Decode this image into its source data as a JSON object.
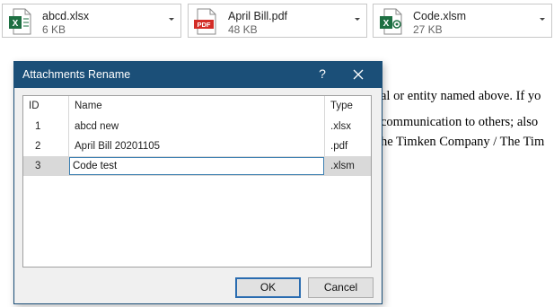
{
  "attachments": [
    {
      "name": "abcd.xlsx",
      "size": "6 KB",
      "icon": "excel-icon",
      "color": "#1d6f42"
    },
    {
      "name": "April Bill.pdf",
      "size": "48 KB",
      "icon": "pdf-icon",
      "color": "#d32d27"
    },
    {
      "name": "Code.xlsm",
      "size": "27 KB",
      "icon": "excel-macro-icon",
      "color": "#1d6f42"
    }
  ],
  "background_text": [
    "al or entity named above. If yo",
    "communication to others; also",
    "he Timken Company / The Tim"
  ],
  "dialog": {
    "title": "Attachments Rename",
    "help": "?",
    "columns": [
      "ID",
      "Name",
      "Type"
    ],
    "rows": [
      {
        "id": "1",
        "name": "abcd new",
        "type": ".xlsx"
      },
      {
        "id": "2",
        "name": "April Bill 20201105",
        "type": ".pdf"
      },
      {
        "id": "3",
        "name": "Code test",
        "type": ".xlsm",
        "selected": true
      }
    ],
    "ok_label": "OK",
    "cancel_label": "Cancel",
    "title_bar_color": "#1b4f78"
  }
}
